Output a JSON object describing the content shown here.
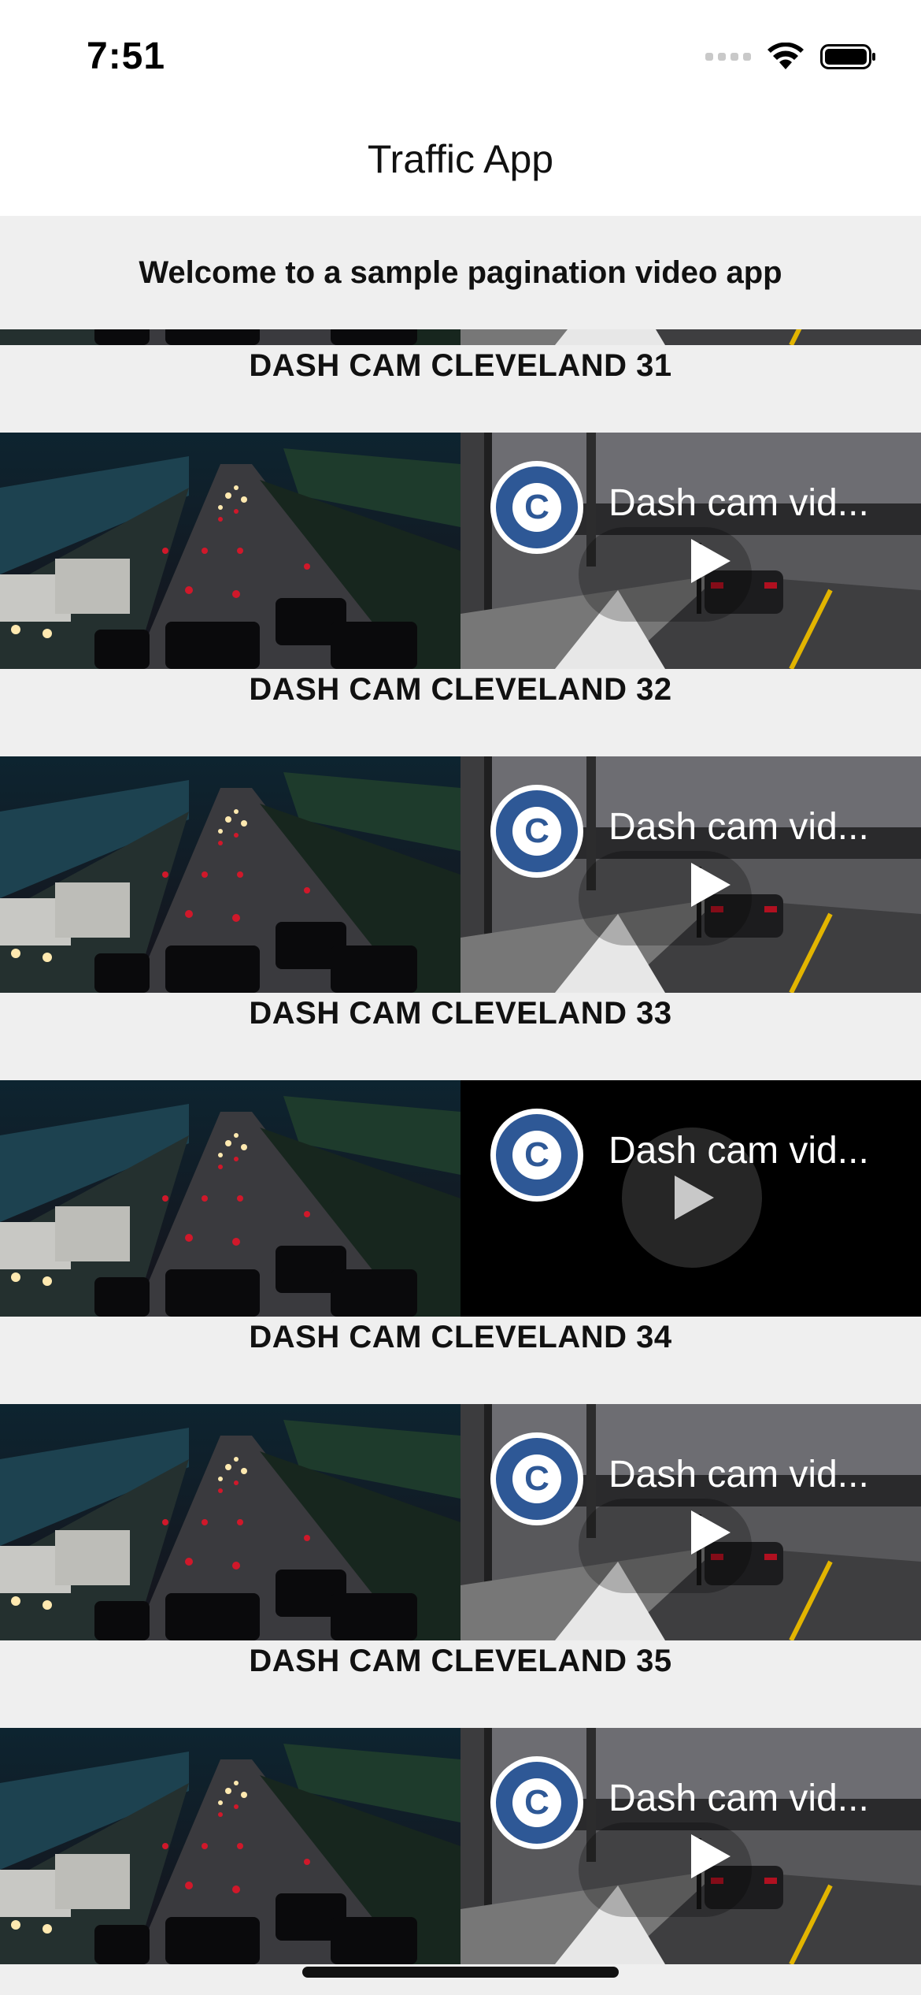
{
  "status_bar": {
    "time": "7:51"
  },
  "nav": {
    "title": "Traffic App"
  },
  "welcome": {
    "text": "Welcome to a sample pagination video app"
  },
  "video": {
    "title": "Dash cam vid...",
    "channel_icon_letter": "C"
  },
  "items": [
    {
      "caption": "DASH CAM CLEVELAND 31",
      "player_state": "paused"
    },
    {
      "caption": "DASH CAM CLEVELAND 32",
      "player_state": "paused"
    },
    {
      "caption": "DASH CAM CLEVELAND 33",
      "player_state": "paused"
    },
    {
      "caption": "DASH CAM CLEVELAND 34",
      "player_state": "loading"
    },
    {
      "caption": "DASH CAM CLEVELAND 35",
      "player_state": "paused"
    },
    {
      "caption": "",
      "player_state": "paused"
    }
  ],
  "colors": {
    "channel_blue": "#2e5896",
    "background": "#efefef",
    "nav_background": "#ffffff"
  }
}
